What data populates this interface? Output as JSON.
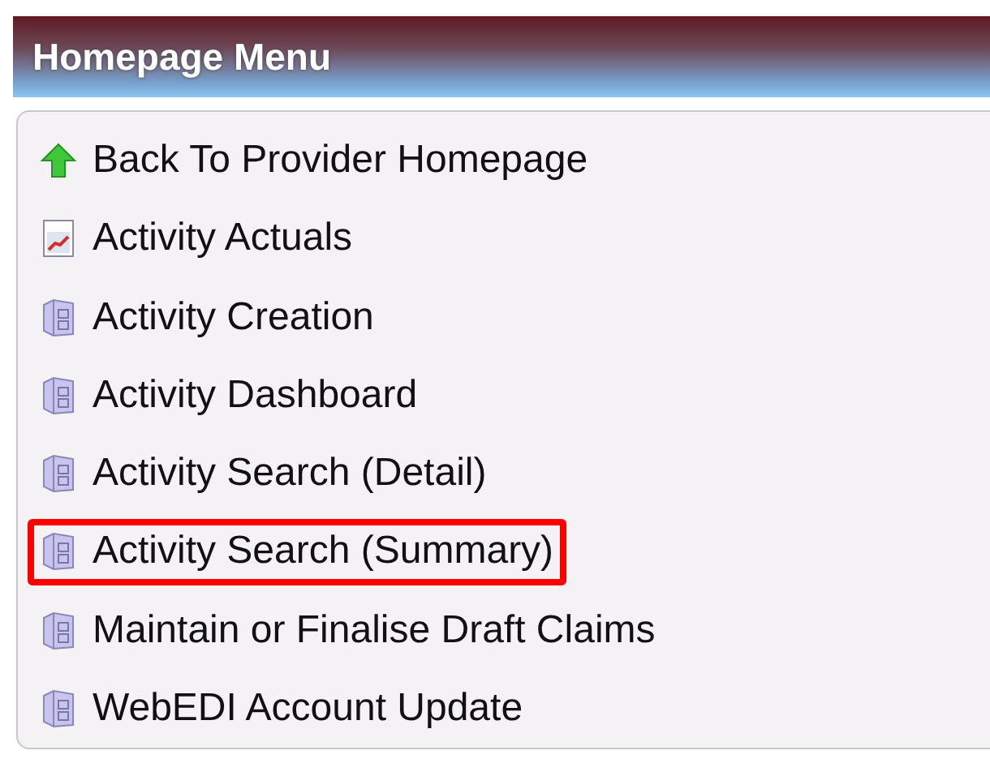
{
  "header": {
    "title": "Homepage Menu"
  },
  "menu": {
    "items": [
      {
        "label": "Back To Provider Homepage",
        "kind": "back",
        "highlighted": false
      },
      {
        "label": "Activity Actuals",
        "kind": "chart",
        "highlighted": false
      },
      {
        "label": "Activity Creation",
        "kind": "cabinet",
        "highlighted": false
      },
      {
        "label": "Activity Dashboard",
        "kind": "cabinet",
        "highlighted": false
      },
      {
        "label": "Activity Search (Detail)",
        "kind": "cabinet",
        "highlighted": false
      },
      {
        "label": "Activity Search (Summary)",
        "kind": "cabinet",
        "highlighted": true
      },
      {
        "label": "Maintain or Finalise Draft Claims",
        "kind": "cabinet",
        "highlighted": false
      },
      {
        "label": "WebEDI Account Update",
        "kind": "cabinet",
        "highlighted": false
      }
    ]
  }
}
